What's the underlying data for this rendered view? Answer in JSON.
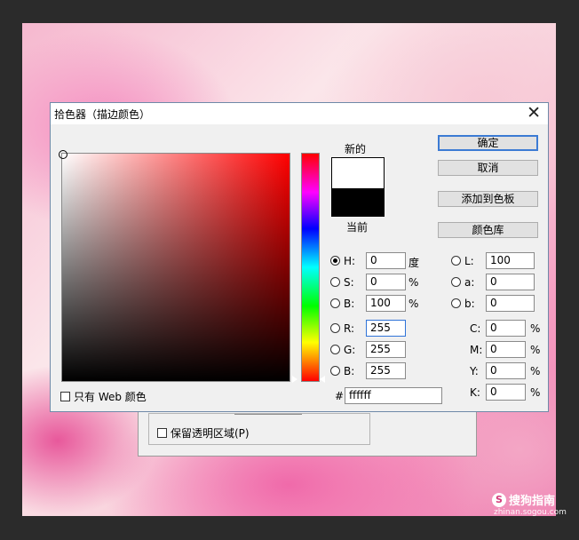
{
  "dialog": {
    "title": "拾色器（描边颜色）",
    "close_glyph": "✕",
    "new_label": "新的",
    "current_label": "当前",
    "new_color": "#ffffff",
    "current_color": "#000000",
    "buttons": {
      "ok": "确定",
      "cancel": "取消",
      "add_swatch": "添加到色板",
      "libraries": "颜色库"
    },
    "hsb": {
      "h_label": "H:",
      "h_value": "0",
      "h_unit": "度",
      "s_label": "S:",
      "s_value": "0",
      "s_unit": "%",
      "b_label": "B:",
      "b_value": "100",
      "b_unit": "%"
    },
    "rgb": {
      "r_label": "R:",
      "r_value": "255",
      "g_label": "G:",
      "g_value": "255",
      "b_label": "B:",
      "b_value": "255"
    },
    "lab": {
      "l_label": "L:",
      "l_value": "100",
      "a_label": "a:",
      "a_value": "0",
      "b_label": "b:",
      "b_value": "0"
    },
    "cmyk": {
      "c_label": "C:",
      "c_value": "0",
      "m_label": "M:",
      "m_value": "0",
      "y_label": "Y:",
      "y_value": "0",
      "k_label": "K:",
      "k_value": "0",
      "unit": "%"
    },
    "hex_label": "#",
    "hex_value": "ffffff",
    "web_only_label": "只有 Web 颜色"
  },
  "background_dialog": {
    "preserve_transparency": "保留透明区域(P)"
  },
  "watermark": {
    "logo_letter": "S",
    "name": "搜狗指南",
    "url": "zhinan.sogou.com"
  },
  "colors": {
    "accent": "#3c7bd4",
    "hue_top": "#ff0000"
  }
}
